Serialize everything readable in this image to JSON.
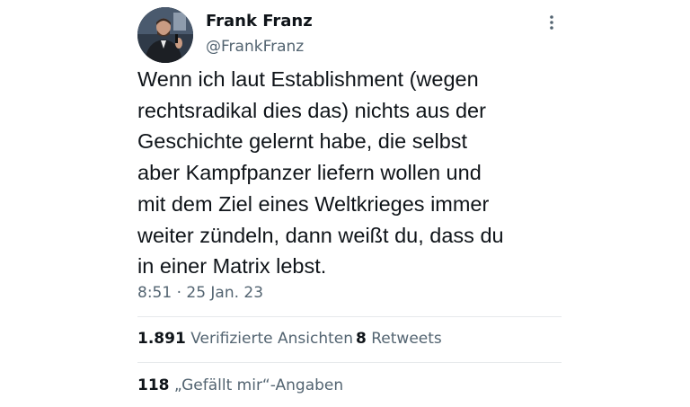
{
  "author": {
    "display_name": "Frank Franz",
    "handle": "@FrankFranz"
  },
  "tweet": {
    "lines": [
      "Wenn ich laut Establishment (wegen",
      "rechtsradikal dies das) nichts aus der",
      "Geschichte gelernt habe, die selbst",
      "aber Kampfpanzer liefern wollen und",
      "mit dem Ziel eines Weltkrieges immer",
      "weiter zündeln, dann weißt du, dass du",
      "in einer Matrix lebst."
    ],
    "timestamp": "8:51 · 25 Jan. 23"
  },
  "stats": {
    "views_count": "1.891",
    "views_label": "Verifizierte Ansichten",
    "retweets_count": "8",
    "retweets_label": "Retweets",
    "likes_count": "118",
    "likes_label": "„Gefällt mir“-Angaben"
  },
  "icons": {
    "more": "more-vertical-icon",
    "avatar": "profile-photo"
  },
  "colors": {
    "text_primary": "#0f1419",
    "text_secondary": "#536471",
    "divider": "#e6e9eb"
  }
}
